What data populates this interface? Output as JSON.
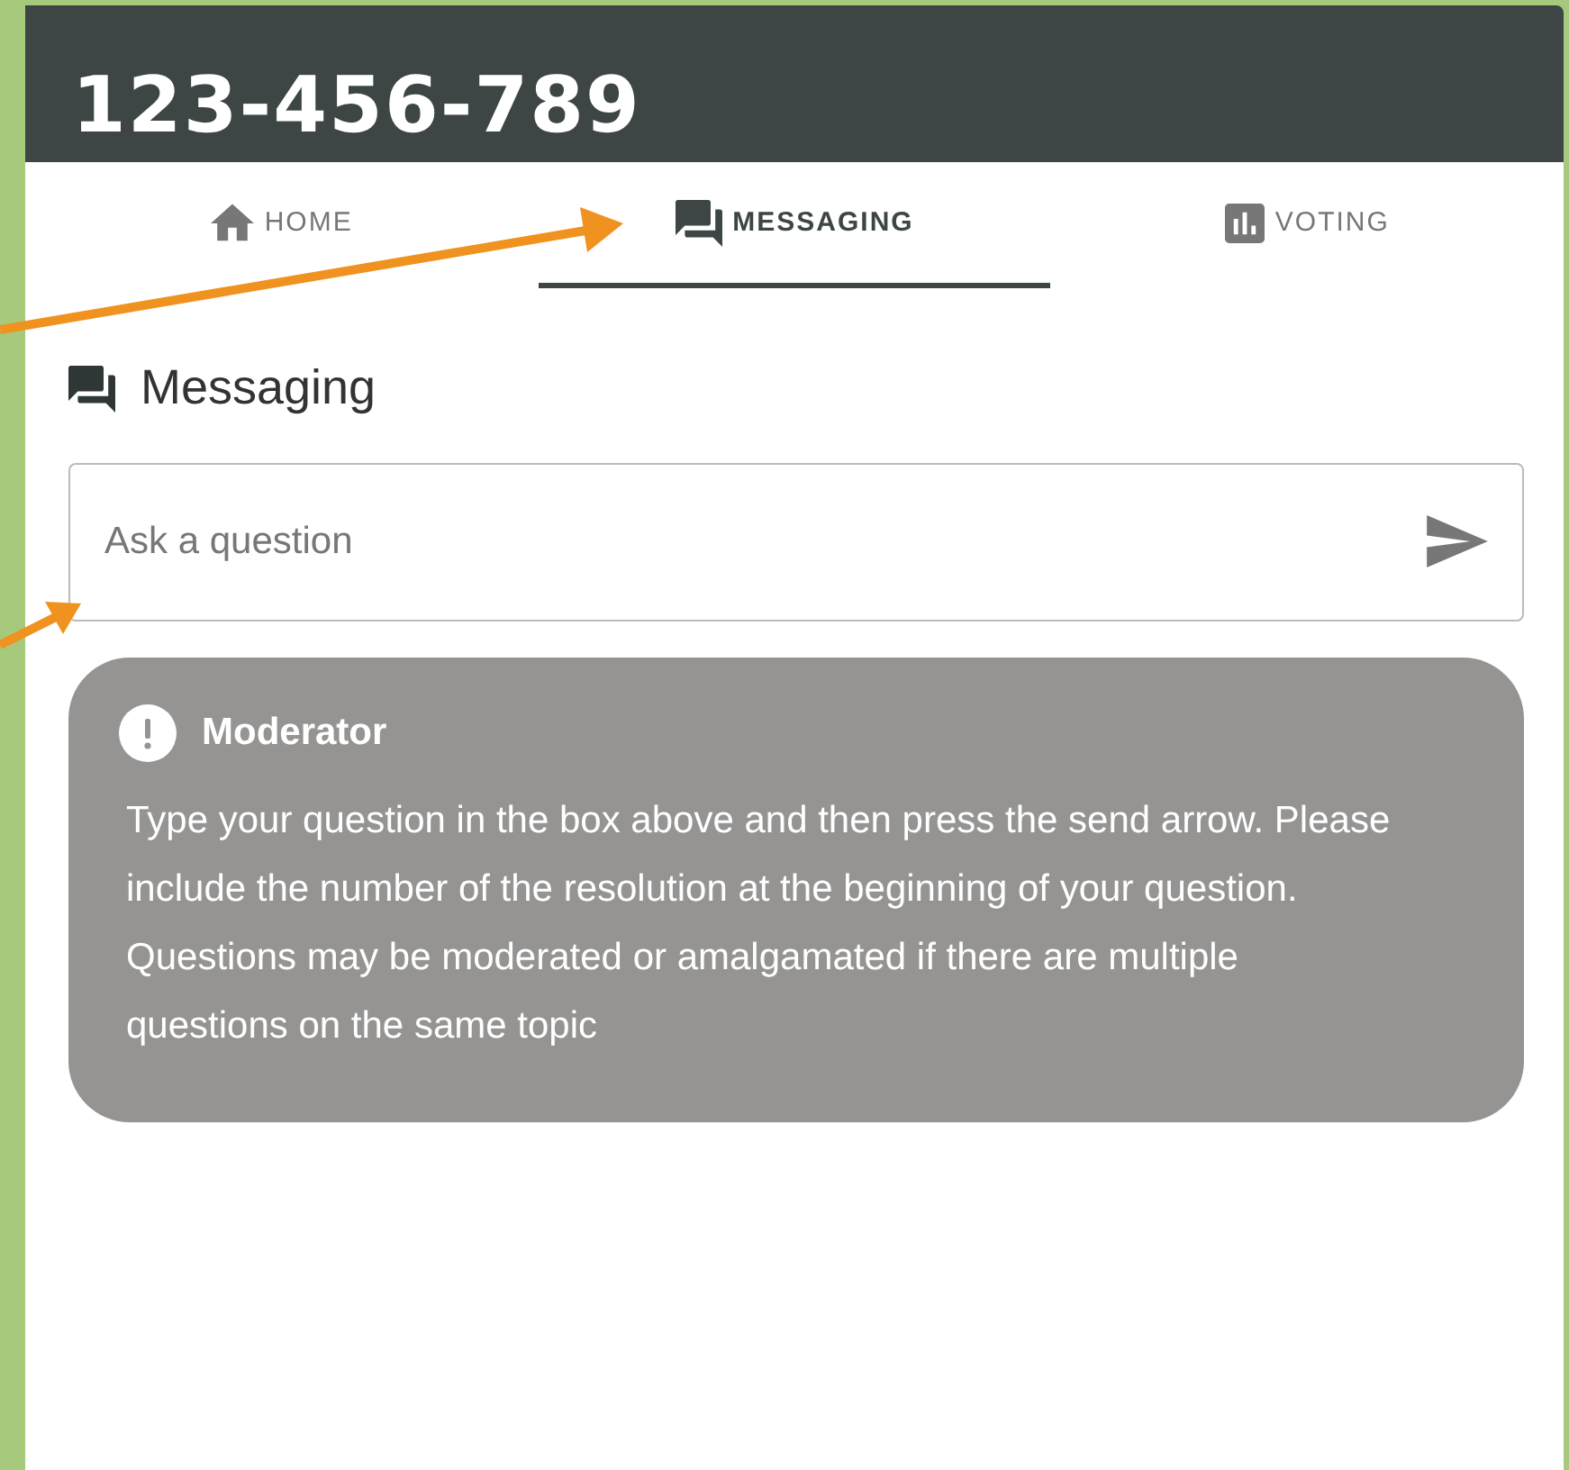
{
  "header": {
    "title": "123-456-789"
  },
  "tabs": [
    {
      "label": "HOME",
      "kind": "home",
      "selected": false
    },
    {
      "label": "MESSAGING",
      "kind": "chat",
      "selected": true
    },
    {
      "label": "VOTING",
      "kind": "chart",
      "selected": false
    }
  ],
  "section": {
    "title": "Messaging"
  },
  "question_field": {
    "placeholder": "Ask a question"
  },
  "notice": {
    "title": "Moderator",
    "text": "Type your question in the box above and then press the send arrow. Please include the number of the resolution at the beginning of your question. Questions may be moderated or amalgamated if there are multiple questions on the same topic"
  }
}
